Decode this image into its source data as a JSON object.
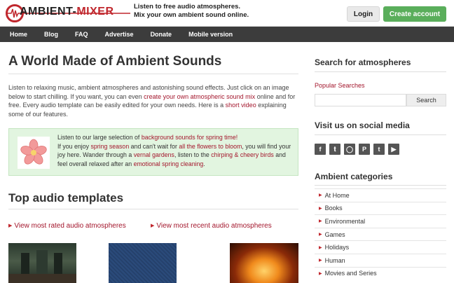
{
  "header": {
    "logo_text_a": "AMBIENT-",
    "logo_text_b": "MIXER",
    "tagline_1": "Listen to free audio atmospheres.",
    "tagline_2": "Mix your own ambient sound online.",
    "login_label": "Login",
    "create_label": "Create account"
  },
  "nav": {
    "items": [
      "Home",
      "Blog",
      "FAQ",
      "Advertise",
      "Donate",
      "Mobile version"
    ]
  },
  "main": {
    "title": "A World Made of Ambient Sounds",
    "intro": {
      "p1": "Listen to relaxing music, ambient atmospheres and astonishing sound effects. Just click on an image below to start chilling. If you want, you can even ",
      "link1": "create your own atmospheric sound mix",
      "p2": " online and for free. Every audio template can be easily edited for your own needs. Here is a ",
      "link2": "short video",
      "p3": " explaining some of our features."
    },
    "spring": {
      "t1": "Listen to our large selection of ",
      "l1": "background sounds for spring time!",
      "t2": "If you enjoy ",
      "l2": "spring season",
      "t3": " and can't wait for ",
      "l3": "all the flowers to bloom",
      "t4": ", you will find your joy here. Wander through a ",
      "l4": "vernal gardens",
      "t5": ", listen to the ",
      "l5": "chirping & cheery birds",
      "t6": " and feel overall relaxed after an ",
      "l6": "emotional spring cleaning",
      "t7": "."
    },
    "section_title": "Top audio templates",
    "view_rated": "View most rated audio atmospheres",
    "view_recent": "View most recent audio atmospheres"
  },
  "sidebar": {
    "search_title": "Search for atmospheres",
    "popular_label": "Popular Searches",
    "search_value": "",
    "search_button": "Search",
    "social_title": "Visit us on social media",
    "social_icons": [
      "f",
      "t",
      "ig",
      "p",
      "t",
      "yt"
    ],
    "categories_title": "Ambient categories",
    "categories": [
      "At Home",
      "Books",
      "Environmental",
      "Games",
      "Holidays",
      "Human",
      "Movies and Series"
    ]
  },
  "colors": {
    "brand_red": "#c0272d",
    "link": "#a3162c",
    "nav_bg": "#3c3c3c",
    "create_green": "#5aae5b",
    "spring_bg": "#e2f5e0"
  }
}
